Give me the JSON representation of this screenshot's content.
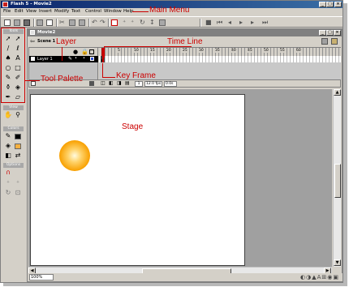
{
  "window": {
    "title": "Flash 5 - Movie2",
    "min": "_",
    "max": "□",
    "close": "×"
  },
  "menu": [
    "File",
    "Edit",
    "View",
    "Insert",
    "Modify",
    "Text",
    "Control",
    "Window",
    "Help"
  ],
  "tools_panel": {
    "header": "Tools",
    "view_header": "View",
    "colors_header": "Colors",
    "options_header": "Options"
  },
  "document": {
    "title": "Movie2",
    "scene": "Scene 1"
  },
  "timeline": {
    "layer_name": "Layer 1",
    "ruler_numbers": [
      "5",
      "10",
      "15",
      "20",
      "25",
      "30",
      "35",
      "40",
      "45",
      "50",
      "55",
      "60"
    ],
    "current_frame": "1",
    "frame_rate": "12.0 fps",
    "elapsed": "0.0s"
  },
  "status": {
    "zoom": "100%"
  },
  "annotations": {
    "main_menu": "Main Menu",
    "layer": "Layer",
    "time_line": "Time Line",
    "tool_palette": "Tool Palette",
    "key_frame": "Key Frame",
    "stage": "Stage"
  },
  "colors": {
    "annotation": "#cc0000",
    "titlebar": "#0a246a",
    "ball_core": "#fffbe0",
    "ball_edge": "#ec8c00"
  }
}
